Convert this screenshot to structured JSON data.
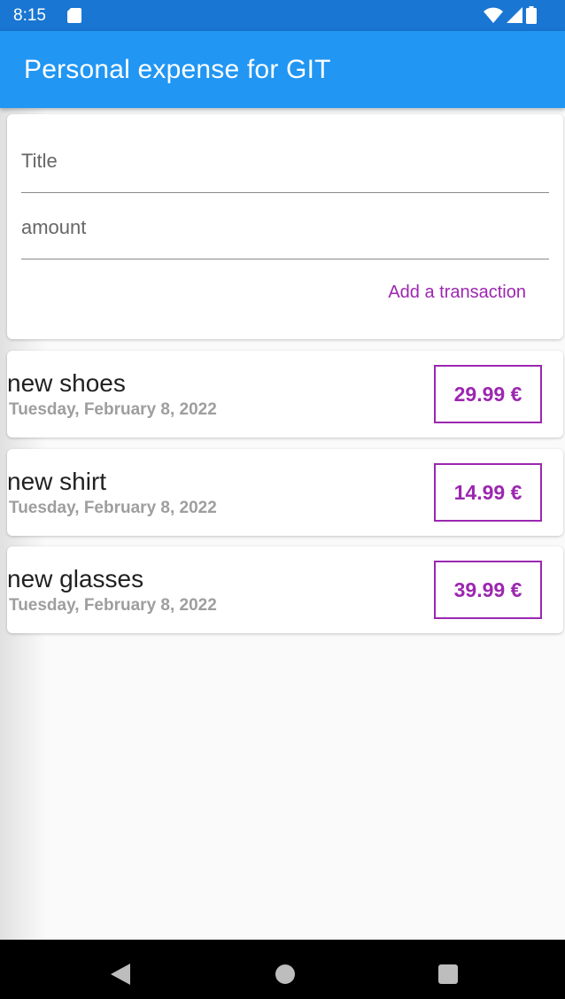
{
  "status_bar": {
    "time": "8:15",
    "icons": [
      "sd-card-icon",
      "wifi-icon",
      "signal-icon",
      "battery-icon"
    ]
  },
  "app_bar": {
    "title": "Personal expense for GIT"
  },
  "form": {
    "title_placeholder": "Title",
    "amount_placeholder": "amount",
    "add_button_label": "Add a transaction"
  },
  "transactions": [
    {
      "title": "new shoes",
      "date": "Tuesday, February 8, 2022",
      "amount": "29.99 €"
    },
    {
      "title": "new shirt",
      "date": "Tuesday, February 8, 2022",
      "amount": "14.99 €"
    },
    {
      "title": "new glasses",
      "date": "Tuesday, February 8, 2022",
      "amount": "39.99 €"
    }
  ],
  "nav_bar": {
    "buttons": [
      "back-icon",
      "home-icon",
      "recents-icon"
    ]
  },
  "colors": {
    "status_bar": "#1976d2",
    "app_bar": "#2196f3",
    "accent": "#9c27b0",
    "background": "#fafafa"
  }
}
